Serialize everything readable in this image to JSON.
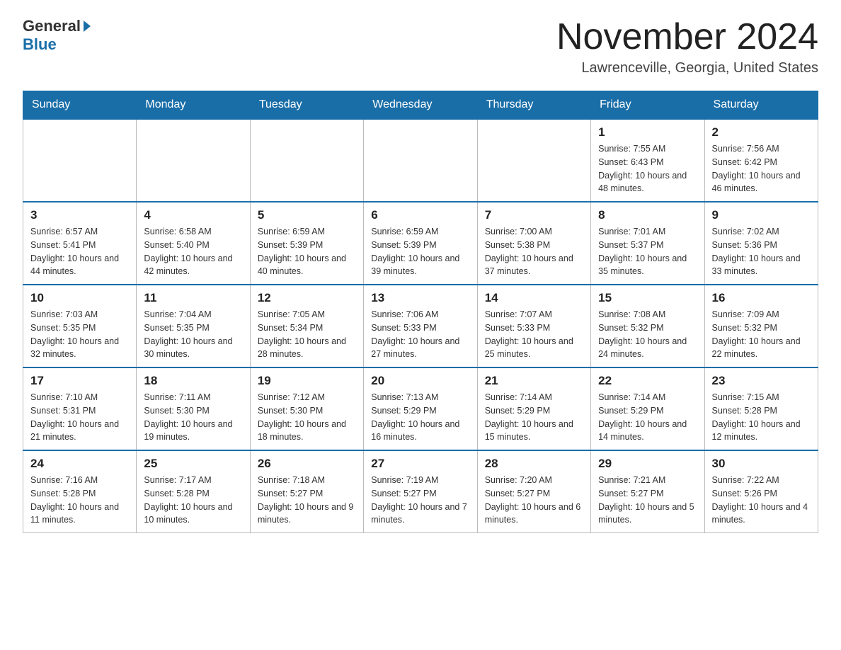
{
  "header": {
    "logo_general": "General",
    "logo_blue": "Blue",
    "month_title": "November 2024",
    "location": "Lawrenceville, Georgia, United States"
  },
  "days_of_week": [
    "Sunday",
    "Monday",
    "Tuesday",
    "Wednesday",
    "Thursday",
    "Friday",
    "Saturday"
  ],
  "weeks": [
    [
      {
        "day": "",
        "info": ""
      },
      {
        "day": "",
        "info": ""
      },
      {
        "day": "",
        "info": ""
      },
      {
        "day": "",
        "info": ""
      },
      {
        "day": "",
        "info": ""
      },
      {
        "day": "1",
        "info": "Sunrise: 7:55 AM\nSunset: 6:43 PM\nDaylight: 10 hours and 48 minutes."
      },
      {
        "day": "2",
        "info": "Sunrise: 7:56 AM\nSunset: 6:42 PM\nDaylight: 10 hours and 46 minutes."
      }
    ],
    [
      {
        "day": "3",
        "info": "Sunrise: 6:57 AM\nSunset: 5:41 PM\nDaylight: 10 hours and 44 minutes."
      },
      {
        "day": "4",
        "info": "Sunrise: 6:58 AM\nSunset: 5:40 PM\nDaylight: 10 hours and 42 minutes."
      },
      {
        "day": "5",
        "info": "Sunrise: 6:59 AM\nSunset: 5:39 PM\nDaylight: 10 hours and 40 minutes."
      },
      {
        "day": "6",
        "info": "Sunrise: 6:59 AM\nSunset: 5:39 PM\nDaylight: 10 hours and 39 minutes."
      },
      {
        "day": "7",
        "info": "Sunrise: 7:00 AM\nSunset: 5:38 PM\nDaylight: 10 hours and 37 minutes."
      },
      {
        "day": "8",
        "info": "Sunrise: 7:01 AM\nSunset: 5:37 PM\nDaylight: 10 hours and 35 minutes."
      },
      {
        "day": "9",
        "info": "Sunrise: 7:02 AM\nSunset: 5:36 PM\nDaylight: 10 hours and 33 minutes."
      }
    ],
    [
      {
        "day": "10",
        "info": "Sunrise: 7:03 AM\nSunset: 5:35 PM\nDaylight: 10 hours and 32 minutes."
      },
      {
        "day": "11",
        "info": "Sunrise: 7:04 AM\nSunset: 5:35 PM\nDaylight: 10 hours and 30 minutes."
      },
      {
        "day": "12",
        "info": "Sunrise: 7:05 AM\nSunset: 5:34 PM\nDaylight: 10 hours and 28 minutes."
      },
      {
        "day": "13",
        "info": "Sunrise: 7:06 AM\nSunset: 5:33 PM\nDaylight: 10 hours and 27 minutes."
      },
      {
        "day": "14",
        "info": "Sunrise: 7:07 AM\nSunset: 5:33 PM\nDaylight: 10 hours and 25 minutes."
      },
      {
        "day": "15",
        "info": "Sunrise: 7:08 AM\nSunset: 5:32 PM\nDaylight: 10 hours and 24 minutes."
      },
      {
        "day": "16",
        "info": "Sunrise: 7:09 AM\nSunset: 5:32 PM\nDaylight: 10 hours and 22 minutes."
      }
    ],
    [
      {
        "day": "17",
        "info": "Sunrise: 7:10 AM\nSunset: 5:31 PM\nDaylight: 10 hours and 21 minutes."
      },
      {
        "day": "18",
        "info": "Sunrise: 7:11 AM\nSunset: 5:30 PM\nDaylight: 10 hours and 19 minutes."
      },
      {
        "day": "19",
        "info": "Sunrise: 7:12 AM\nSunset: 5:30 PM\nDaylight: 10 hours and 18 minutes."
      },
      {
        "day": "20",
        "info": "Sunrise: 7:13 AM\nSunset: 5:29 PM\nDaylight: 10 hours and 16 minutes."
      },
      {
        "day": "21",
        "info": "Sunrise: 7:14 AM\nSunset: 5:29 PM\nDaylight: 10 hours and 15 minutes."
      },
      {
        "day": "22",
        "info": "Sunrise: 7:14 AM\nSunset: 5:29 PM\nDaylight: 10 hours and 14 minutes."
      },
      {
        "day": "23",
        "info": "Sunrise: 7:15 AM\nSunset: 5:28 PM\nDaylight: 10 hours and 12 minutes."
      }
    ],
    [
      {
        "day": "24",
        "info": "Sunrise: 7:16 AM\nSunset: 5:28 PM\nDaylight: 10 hours and 11 minutes."
      },
      {
        "day": "25",
        "info": "Sunrise: 7:17 AM\nSunset: 5:28 PM\nDaylight: 10 hours and 10 minutes."
      },
      {
        "day": "26",
        "info": "Sunrise: 7:18 AM\nSunset: 5:27 PM\nDaylight: 10 hours and 9 minutes."
      },
      {
        "day": "27",
        "info": "Sunrise: 7:19 AM\nSunset: 5:27 PM\nDaylight: 10 hours and 7 minutes."
      },
      {
        "day": "28",
        "info": "Sunrise: 7:20 AM\nSunset: 5:27 PM\nDaylight: 10 hours and 6 minutes."
      },
      {
        "day": "29",
        "info": "Sunrise: 7:21 AM\nSunset: 5:27 PM\nDaylight: 10 hours and 5 minutes."
      },
      {
        "day": "30",
        "info": "Sunrise: 7:22 AM\nSunset: 5:26 PM\nDaylight: 10 hours and 4 minutes."
      }
    ]
  ]
}
